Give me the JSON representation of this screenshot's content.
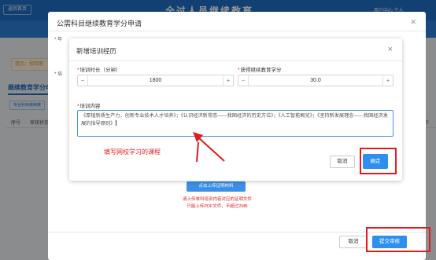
{
  "background": {
    "header": {
      "back_button": "返回首页",
      "title": "全过人员继续教育",
      "user_area": "用户中心  个人"
    },
    "tip": "提示：校验审",
    "section_title": "继续教育学分申",
    "filter_button": "专业科目继续教",
    "table_headers": [
      "序号",
      "审核状态"
    ],
    "table_header_right": "操作"
  },
  "outer_dialog": {
    "title": "公需科目继续教育学分申请",
    "close_icon": "×",
    "field_markers": [
      "* 年",
      "* 培"
    ],
    "upload_button": "点击上传证明材料",
    "upload_notes": [
      "请上传单科培训内容对应的证明文件",
      "只能上传PDF文件，不超过2MB"
    ],
    "cancel_label": "取消",
    "submit_label": "提交审核"
  },
  "inner_dialog": {
    "title": "新增培训经历",
    "close_icon": "×",
    "duration": {
      "label": "培训时长（分钟）",
      "value": "1800",
      "minus": "−",
      "plus": "+"
    },
    "credits": {
      "label": "获得继续教育学分",
      "value": "30.0",
      "minus": "−",
      "plus": "+"
    },
    "content": {
      "label": "培训内容",
      "value": "《厚植新质生产力，创新专业技术人才培养》；《认识经济新常态——我国经济的历史方位》；《人工智能概览》；《坚持新发展理念——我国经济发展的指导原则》"
    },
    "cancel_label": "取消",
    "confirm_label": "确定"
  },
  "annotation": {
    "text": "填写网校学习的课程",
    "color": "#e41b1b"
  },
  "colors": {
    "primary": "#2d8ff0",
    "header": "#1f6fc6",
    "highlight": "#e41b1b"
  }
}
